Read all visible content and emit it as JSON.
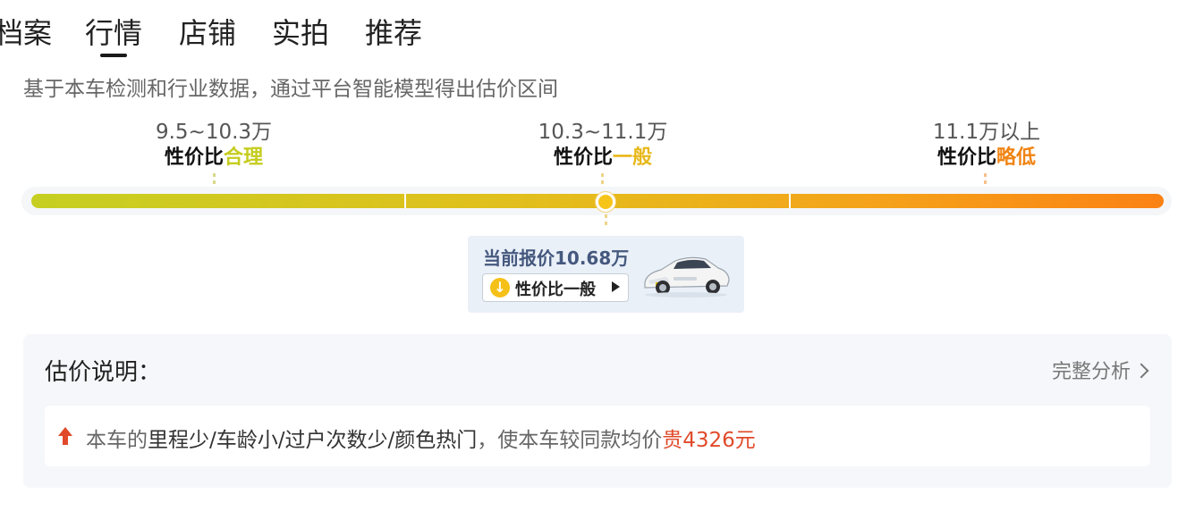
{
  "tabs": [
    {
      "label": "档案"
    },
    {
      "label": "行情",
      "active": true
    },
    {
      "label": "店铺"
    },
    {
      "label": "实拍"
    },
    {
      "label": "推荐"
    }
  ],
  "subtitle": "基于本车检测和行业数据，通过平台智能模型得出估价区间",
  "ranges": [
    {
      "price": "9.5~10.3万",
      "rating_prefix": "性价比",
      "rating_value": "合理",
      "color": "#c5cc1e"
    },
    {
      "price": "10.3~11.1万",
      "rating_prefix": "性价比",
      "rating_value": "一般",
      "color": "#e8b81a"
    },
    {
      "price": "11.1万以上",
      "rating_prefix": "性价比",
      "rating_value": "略低",
      "color": "#f08414"
    }
  ],
  "bar": {
    "position_fraction": 0.5,
    "colors": [
      "#c6cf22",
      "#e3be1c",
      "#f5a21a",
      "#fb8214"
    ]
  },
  "current": {
    "title": "当前报价10.68万",
    "rating_label": "性价比一般"
  },
  "explanation": {
    "title": "估价说明：",
    "link_label": "完整分析",
    "reason_prefix": "本车的",
    "reason_factors": "里程少/车龄小/过户次数少/颜色热门",
    "reason_middle": "，使本车较同款均价",
    "reason_result": "贵4326元"
  }
}
